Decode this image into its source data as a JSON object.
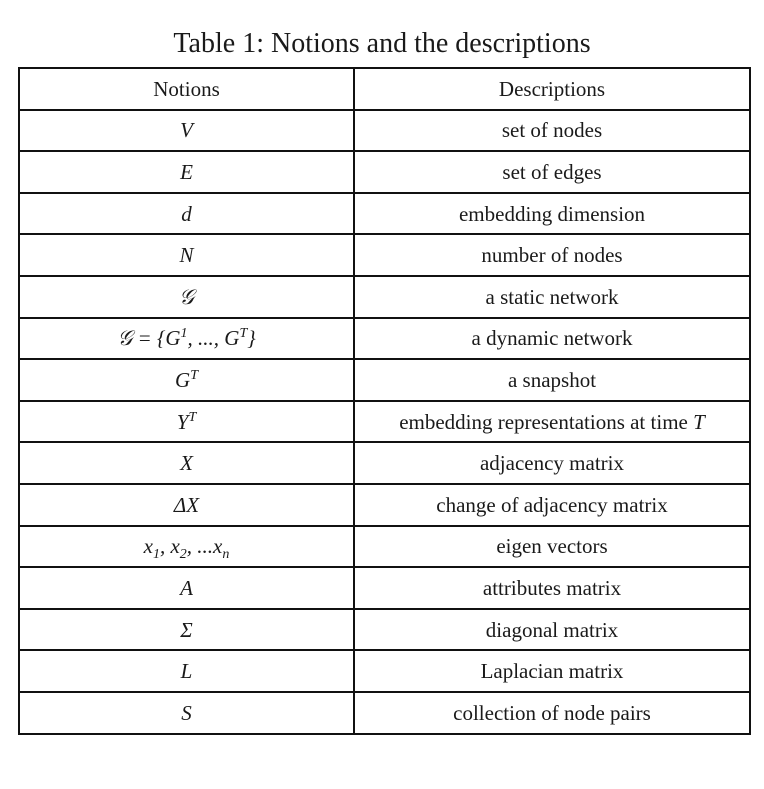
{
  "caption": "Table 1: Notions and the descriptions",
  "table": {
    "headers": [
      "Notions",
      "Descriptions"
    ],
    "rows": [
      {
        "notion": "V",
        "description": "set of nodes"
      },
      {
        "notion": "E",
        "description": "set of edges"
      },
      {
        "notion": "d",
        "description": "embedding dimension"
      },
      {
        "notion": "N",
        "description": "number of nodes"
      },
      {
        "notion": "𝒢",
        "description": "a static network"
      },
      {
        "notion": "𝒢 = {G1, ..., GT}",
        "description": "a dynamic network"
      },
      {
        "notion": "GT",
        "description": "a snapshot"
      },
      {
        "notion": "YT",
        "description": "embedding representations at time T"
      },
      {
        "notion": "X",
        "description": "adjacency matrix"
      },
      {
        "notion": "ΔX",
        "description": "change of adjacency matrix"
      },
      {
        "notion": "x1, x2, ...xn",
        "description": "eigen vectors"
      },
      {
        "notion": "A",
        "description": "attributes matrix"
      },
      {
        "notion": "Σ",
        "description": "diagonal matrix"
      },
      {
        "notion": "L",
        "description": "Laplacian matrix"
      },
      {
        "notion": "S",
        "description": "collection of node pairs"
      }
    ]
  }
}
